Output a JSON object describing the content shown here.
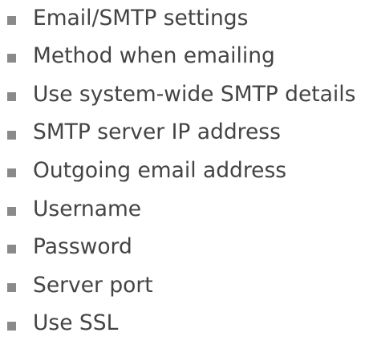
{
  "settings_list": {
    "bullet_color": "#8a8a8a",
    "text_color": "#444444",
    "items": [
      "Email/SMTP settings",
      "Method when emailing",
      "Use system-wide SMTP details",
      "SMTP server IP address",
      "Outgoing email address",
      "Username",
      "Password",
      "Server port",
      "Use SSL"
    ]
  }
}
